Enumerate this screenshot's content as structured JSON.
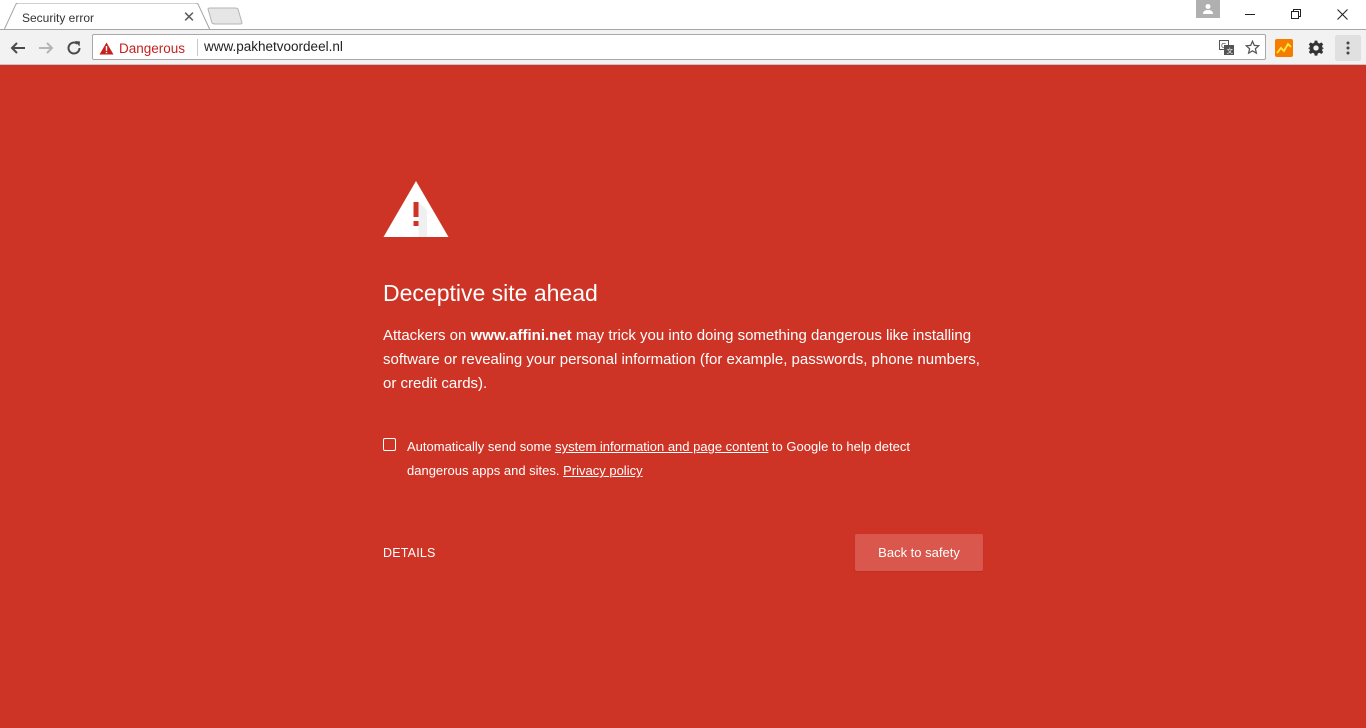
{
  "tab": {
    "title": "Security error",
    "close_glyph": "✕"
  },
  "toolbar": {
    "security_label": "Dangerous",
    "url": "www.pakhetvoordeel.nl"
  },
  "icons": {
    "back": "back-arrow-icon",
    "forward": "forward-arrow-icon",
    "reload": "reload-icon",
    "danger": "warning-triangle-icon",
    "translate": "translate-icon",
    "bookmark": "star-icon",
    "extension_chart": "chart-extension-icon",
    "extension_gear": "gear-icon",
    "menu": "vertical-dots-icon",
    "profile": "person-icon"
  },
  "interstitial": {
    "heading": "Deceptive site ahead",
    "body_prefix": "Attackers on ",
    "body_domain": "www.affini.net",
    "body_suffix": " may trick you into doing something dangerous like installing software or revealing your personal information (for example, passwords, phone numbers, or credit cards).",
    "checkbox_prefix": "Automatically send some ",
    "checkbox_link": "system information and page content",
    "checkbox_middle": " to Google to help detect dangerous apps and sites. ",
    "privacy_link": "Privacy policy",
    "details_label": "DETAILS",
    "safety_label": "Back to safety",
    "checkbox_checked": false
  },
  "colors": {
    "background": "#ce3426",
    "button": "#d9574c",
    "danger_text": "#c5221f",
    "toolbar": "#f2f2f2"
  }
}
